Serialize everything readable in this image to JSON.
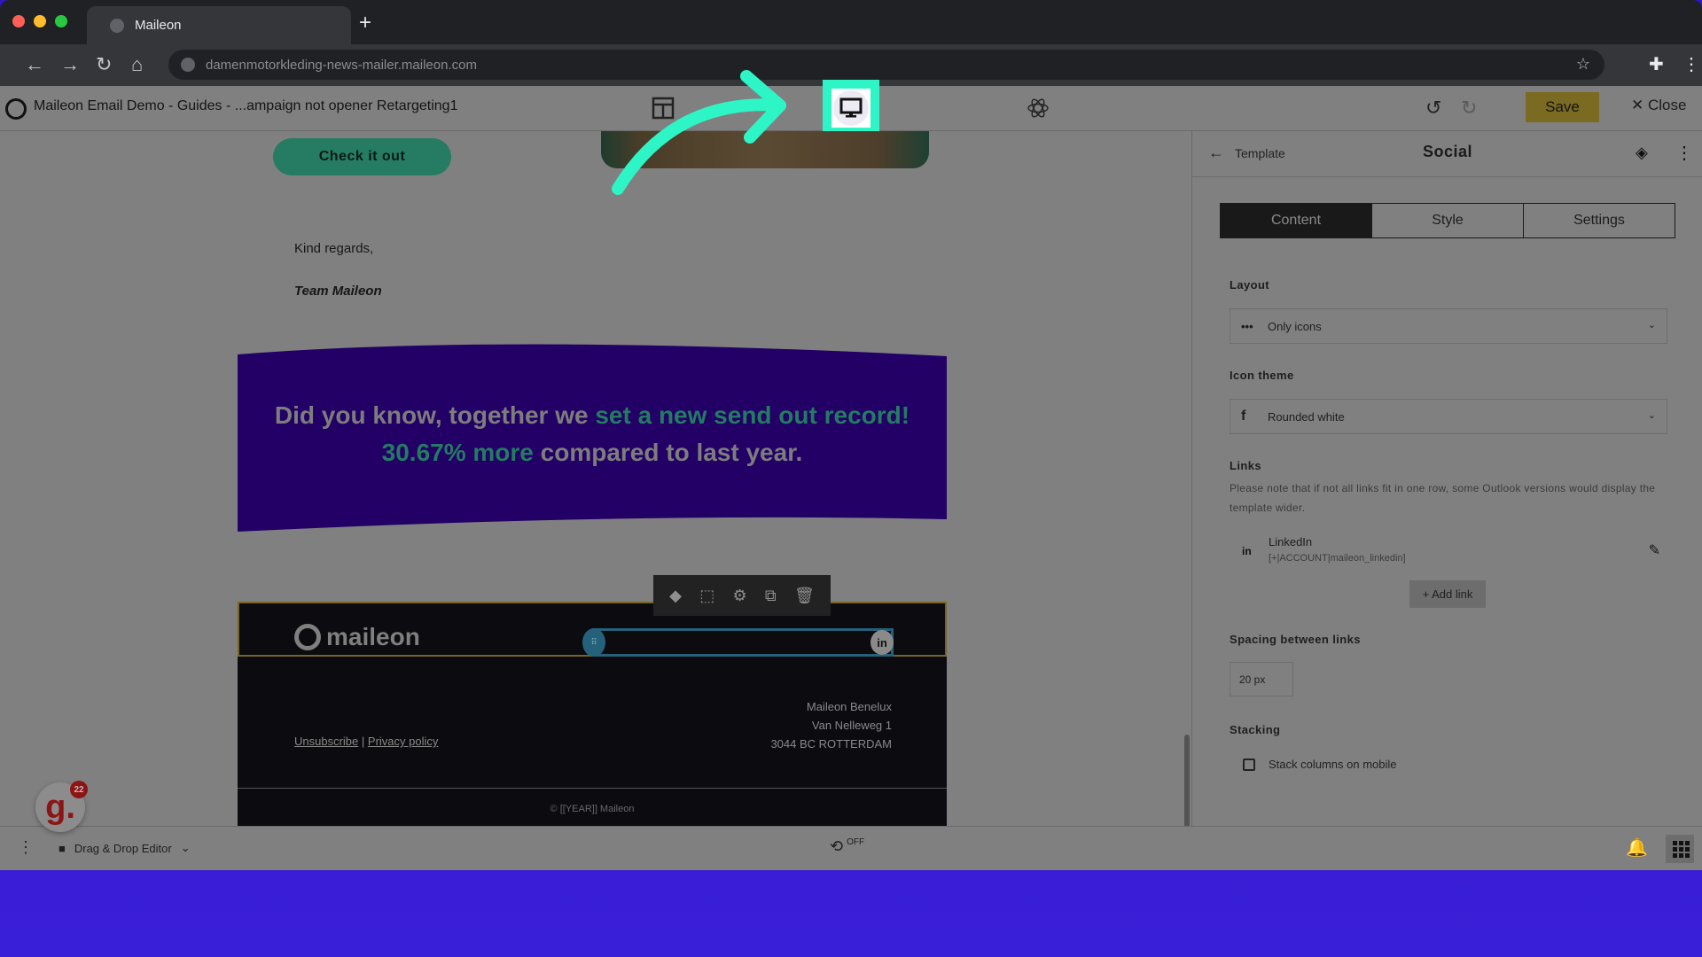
{
  "browser": {
    "tab_title": "Maileon",
    "new_tab": "+",
    "url": "damenmotorkleding-news-mailer.maileon.com"
  },
  "app_header": {
    "title": "Maileon Email Demo - Guides - ...ampaign not opener Retargeting1",
    "save_label": "Save",
    "close_label": "✕ Close",
    "icons": [
      "layout-grid-icon",
      "desktop-preview-icon",
      "atom-icon",
      "undo-icon",
      "redo-icon"
    ]
  },
  "email": {
    "cta_label": "Check it out",
    "regards": "Kind regards,",
    "signature": "Team Maileon",
    "banner": {
      "part1": "Did you know, together we ",
      "highlight1": "set a new send out record! 30.67% more",
      "part2": " compared to last year.",
      "background_color": "#220066",
      "highlight_color": "#247b62"
    },
    "footer": {
      "logo_text": "maileon",
      "social_link_icon": "in",
      "address": [
        "Maileon Benelux",
        "Van Nelleweg 1",
        "3044 BC  ROTTERDAM"
      ],
      "unsubscribe": "Unsubscribe",
      "separator": "|",
      "privacy": "Privacy policy",
      "copyright": "© [[YEAR]] Maileon"
    },
    "block_toolbar": [
      "layers-icon",
      "select-parent-icon",
      "settings-icon",
      "duplicate-icon",
      "delete-icon"
    ]
  },
  "panel": {
    "back_label": "Template",
    "title": "Social",
    "tabs": [
      {
        "label": "Content",
        "active": true
      },
      {
        "label": "Style",
        "active": false
      },
      {
        "label": "Settings",
        "active": false
      }
    ],
    "layout": {
      "label": "Layout",
      "value": "Only icons",
      "icon": "•••"
    },
    "icon_theme": {
      "label": "Icon theme",
      "value": "Rounded white",
      "icon": "f"
    },
    "links": {
      "label": "Links",
      "note": "Please note that if not all links fit in one row, some Outlook versions would display the template wider.",
      "items": [
        {
          "icon": "in",
          "name": "LinkedIn",
          "url": "[+|ACCOUNT|maileon_linkedin]"
        }
      ],
      "add_label": "+ Add link"
    },
    "spacing": {
      "label": "Spacing between links",
      "value": "20 px"
    },
    "stacking": {
      "label": "Stacking",
      "checkbox_label": "Stack columns on mobile",
      "checked": false
    }
  },
  "statusbar": {
    "editor_label": "Drag & Drop Editor",
    "timer_state": "OFF",
    "notification_badge": "22",
    "badge_letter": "g."
  },
  "colors": {
    "highlight_annotation": "#2ef5c6",
    "save_button": "#7a6a22",
    "page_background": "#3519d2"
  }
}
